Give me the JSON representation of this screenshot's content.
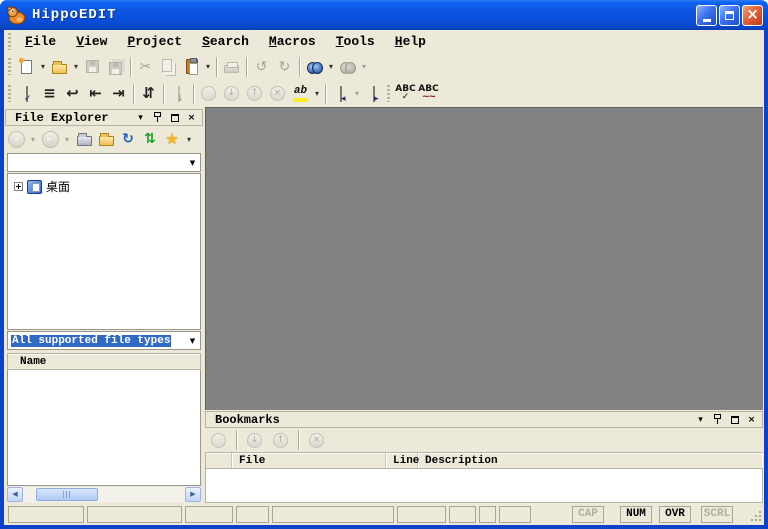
{
  "window": {
    "title": "HippoEDIT"
  },
  "menu": {
    "items": [
      {
        "label": "File"
      },
      {
        "label": "View"
      },
      {
        "label": "Project"
      },
      {
        "label": "Search"
      },
      {
        "label": "Macros"
      },
      {
        "label": "Tools"
      },
      {
        "label": "Help"
      }
    ]
  },
  "icons": {
    "dropdown": "▾",
    "combo_arrow": "▼",
    "close": "×",
    "cut": "✂",
    "undo": "↺",
    "redo": "↻",
    "back": "◀",
    "forward": "▶",
    "refresh": "↻",
    "sync": "⇅",
    "favorites": "★",
    "align_lines": "≡",
    "word_wrap": "↩",
    "outdent": "⇤",
    "indent": "⇥",
    "sort_lines": "⇵",
    "down": "↓",
    "up": "↑",
    "clear": "×",
    "highlight": "ab",
    "spell": "ABC",
    "spell_check": "✓",
    "spell_wave": "~~",
    "page_left": "◂",
    "page_right": "▸",
    "page_down": "↓",
    "scroll_left": "◀",
    "scroll_right": "▶"
  },
  "file_explorer": {
    "title": "File Explorer",
    "address_value": "",
    "tree_items": [
      {
        "label": "桌面"
      }
    ],
    "filter_value": "All supported file types",
    "list_header": "Name"
  },
  "bookmarks": {
    "title": "Bookmarks",
    "columns": [
      "File",
      "Line",
      "Description"
    ],
    "rows": []
  },
  "status": {
    "indicators": [
      {
        "label": "CAP",
        "active": false
      },
      {
        "label": "NUM",
        "active": true
      },
      {
        "label": "OVR",
        "active": true
      },
      {
        "label": "SCRL",
        "active": false
      }
    ]
  }
}
